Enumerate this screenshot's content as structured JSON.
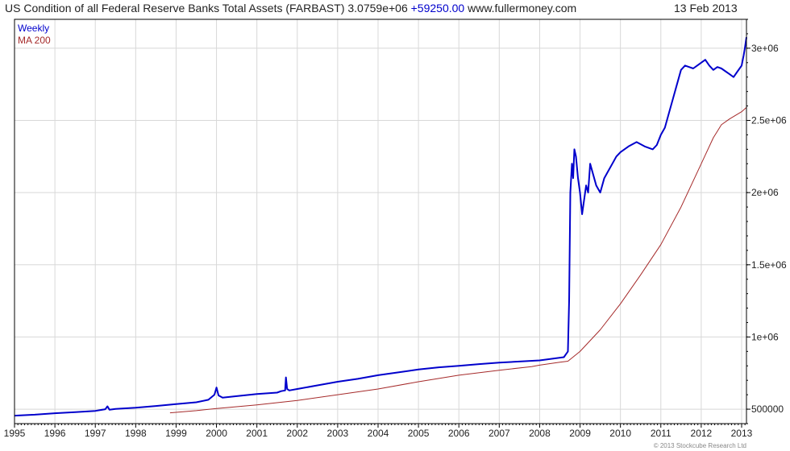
{
  "header": {
    "title": "US Condition of all Federal Reserve Banks Total Assets (FARBAST)",
    "last_value": "3.0759e+06",
    "change": "+59250.00",
    "site": "www.fullermoney.com",
    "date": "13 Feb 2013"
  },
  "copyright": "© 2013 Stockcube Research Ltd",
  "colors": {
    "weekly": "#0000cc",
    "ma": "#a52a2a",
    "change": "#0000cc",
    "grid": "#d8d8d8",
    "frame": "#000000"
  },
  "chart_data": {
    "type": "line",
    "x_tick_labels": [
      "1995",
      "1996",
      "1997",
      "1998",
      "1999",
      "2000",
      "2001",
      "2002",
      "2003",
      "2004",
      "2005",
      "2006",
      "2007",
      "2008",
      "2009",
      "2010",
      "2011",
      "2012",
      "2013"
    ],
    "xlim": [
      1995.0,
      2013.12
    ],
    "ylim": [
      400000,
      3200000
    ],
    "y_ticks": [
      500000,
      1000000,
      1500000,
      2000000,
      2500000,
      3000000
    ],
    "y_tick_labels": [
      "500000",
      "1e+06",
      "1.5e+06",
      "2e+06",
      "2.5e+06",
      "3e+06"
    ],
    "grid": true,
    "legend_position": "top-left",
    "series": [
      {
        "name": "Weekly",
        "x": [
          1995.0,
          1995.5,
          1996.0,
          1996.5,
          1997.0,
          1997.25,
          1997.3,
          1997.35,
          1997.5,
          1998.0,
          1998.5,
          1999.0,
          1999.5,
          1999.8,
          1999.95,
          2000.0,
          2000.05,
          2000.15,
          2000.5,
          2001.0,
          2001.5,
          2001.6,
          2001.7,
          2001.72,
          2001.75,
          2001.8,
          2002.0,
          2002.5,
          2003.0,
          2003.5,
          2004.0,
          2004.5,
          2005.0,
          2005.5,
          2006.0,
          2006.5,
          2007.0,
          2007.5,
          2008.0,
          2008.6,
          2008.65,
          2008.7,
          2008.73,
          2008.76,
          2008.8,
          2008.83,
          2008.86,
          2008.9,
          2008.95,
          2009.0,
          2009.05,
          2009.1,
          2009.15,
          2009.2,
          2009.25,
          2009.3,
          2009.4,
          2009.5,
          2009.6,
          2009.7,
          2009.8,
          2009.9,
          2010.0,
          2010.2,
          2010.4,
          2010.6,
          2010.8,
          2010.9,
          2011.0,
          2011.1,
          2011.2,
          2011.3,
          2011.4,
          2011.5,
          2011.6,
          2011.7,
          2011.8,
          2011.9,
          2012.0,
          2012.1,
          2012.2,
          2012.3,
          2012.4,
          2012.5,
          2012.6,
          2012.7,
          2012.8,
          2012.9,
          2013.0,
          2013.05,
          2013.08,
          2013.12
        ],
        "y": [
          455000,
          462000,
          472000,
          480000,
          488000,
          500000,
          520000,
          496000,
          502000,
          510000,
          522000,
          535000,
          548000,
          565000,
          600000,
          650000,
          595000,
          580000,
          590000,
          605000,
          615000,
          625000,
          630000,
          720000,
          640000,
          630000,
          640000,
          665000,
          690000,
          710000,
          735000,
          755000,
          775000,
          790000,
          800000,
          812000,
          822000,
          830000,
          838000,
          860000,
          880000,
          900000,
          1250000,
          2000000,
          2200000,
          2100000,
          2300000,
          2250000,
          2100000,
          2000000,
          1850000,
          1950000,
          2050000,
          2000000,
          2200000,
          2150000,
          2050000,
          2000000,
          2100000,
          2150000,
          2200000,
          2250000,
          2280000,
          2320000,
          2350000,
          2320000,
          2300000,
          2330000,
          2400000,
          2450000,
          2550000,
          2650000,
          2750000,
          2850000,
          2880000,
          2870000,
          2860000,
          2880000,
          2900000,
          2920000,
          2880000,
          2850000,
          2870000,
          2860000,
          2840000,
          2820000,
          2800000,
          2840000,
          2880000,
          2950000,
          3000000,
          3075900
        ]
      },
      {
        "name": "MA 200",
        "x": [
          1998.85,
          1999.5,
          2000.0,
          2001.0,
          2002.0,
          2003.0,
          2004.0,
          2005.0,
          2006.0,
          2007.0,
          2007.8,
          2008.0,
          2008.5,
          2008.7,
          2009.0,
          2009.5,
          2010.0,
          2010.5,
          2011.0,
          2011.5,
          2012.0,
          2012.3,
          2012.5,
          2012.7,
          2013.0,
          2013.12
        ],
        "y": [
          475000,
          490000,
          505000,
          530000,
          560000,
          600000,
          640000,
          690000,
          735000,
          770000,
          795000,
          805000,
          825000,
          832000,
          900000,
          1050000,
          1230000,
          1430000,
          1640000,
          1900000,
          2200000,
          2380000,
          2470000,
          2510000,
          2560000,
          2590000
        ]
      }
    ]
  }
}
